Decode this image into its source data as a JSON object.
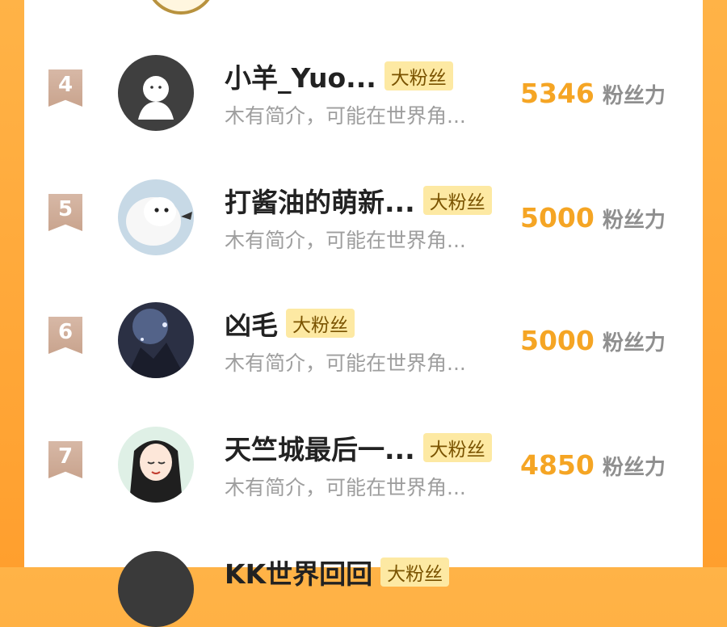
{
  "badge_label": "大粉丝",
  "score_label": "粉丝力",
  "entries": [
    {
      "rank": "4",
      "name": "小羊_Yuo...",
      "bio": "木有简介，可能在世界角...",
      "score": "5346"
    },
    {
      "rank": "5",
      "name": "打酱油的萌新...",
      "bio": "木有简介，可能在世界角...",
      "score": "5000"
    },
    {
      "rank": "6",
      "name": "凶毛",
      "bio": "木有简介，可能在世界角...",
      "score": "5000"
    },
    {
      "rank": "7",
      "name": "天竺城最后一...",
      "bio": "木有简介，可能在世界角...",
      "score": "4850"
    },
    {
      "rank": "",
      "name": "KK世界回回",
      "bio": "",
      "score": ""
    }
  ],
  "colors": {
    "background": "#ff9f2e",
    "score": "#f5a524",
    "badge_bg": "#fde9a3",
    "rank_flag": "#c9a48e"
  },
  "icons": [
    "rank-flag-icon"
  ]
}
